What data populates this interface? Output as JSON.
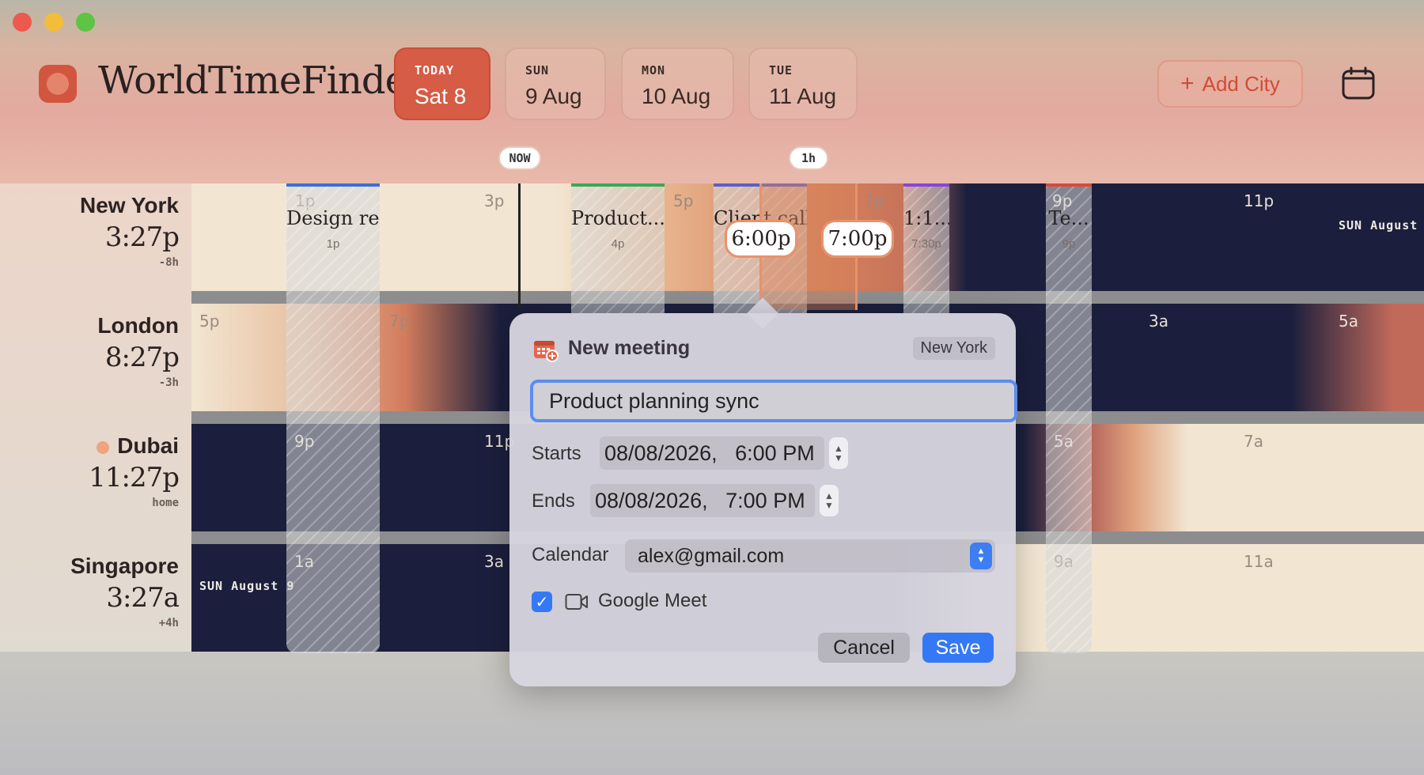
{
  "app": {
    "title": "WorldTimeFinder"
  },
  "days": [
    {
      "weekday": "TODAY",
      "date": "Sat 8",
      "active": true
    },
    {
      "weekday": "SUN",
      "date": "9 Aug"
    },
    {
      "weekday": "MON",
      "date": "10 Aug"
    },
    {
      "weekday": "TUE",
      "date": "11 Aug"
    }
  ],
  "header": {
    "add_city": "Add City",
    "add_icon": "+",
    "calendar_icon": "calendar-icon"
  },
  "markers": {
    "now": "NOW",
    "duration": "1h"
  },
  "cities": [
    {
      "name": "New York",
      "time": "3:27p",
      "offset": "-8h"
    },
    {
      "name": "London",
      "time": "8:27p",
      "offset": "-3h"
    },
    {
      "name": "Dubai",
      "time": "11:27p",
      "offset": "home"
    },
    {
      "name": "Singapore",
      "time": "3:27a",
      "offset": "+4h"
    }
  ],
  "ticks": {
    "ny": [
      "1p",
      "3p",
      "5p",
      "7p",
      "9p",
      "11p"
    ],
    "london": [
      "5p",
      "7p",
      "3a",
      "5a"
    ],
    "dubai": [
      "9p",
      "11p",
      "5a",
      "7a"
    ],
    "singapore": [
      "1a",
      "3a",
      "9a",
      "11a"
    ]
  },
  "date_labels": {
    "ny": "SUN August",
    "singapore": "SUN August 9"
  },
  "events": [
    {
      "title": "Design re...",
      "time": "1p",
      "color": "#3a6fd8"
    },
    {
      "title": "Product...",
      "time": "4p",
      "color": "#3aa856"
    },
    {
      "title": "Client call",
      "time": "",
      "color": "#5a60c8"
    },
    {
      "title": "1:1...",
      "time": "7:30p",
      "color": "#8a44d8"
    },
    {
      "title": "Te...",
      "time": "9p",
      "color": "#d84a3a"
    }
  ],
  "selection": {
    "start": "6:00p",
    "end": "7:00p"
  },
  "modal": {
    "title": "New meeting",
    "city": "New York",
    "meeting_name": "Product planning sync",
    "starts_label": "Starts",
    "starts_value": "08/08/2026,   6:00 PM",
    "ends_label": "Ends",
    "ends_value": "08/08/2026,   7:00 PM",
    "calendar_label": "Calendar",
    "calendar_value": "alex@gmail.com",
    "meet_label": "Google Meet",
    "meet_checked": true,
    "cancel": "Cancel",
    "save": "Save"
  },
  "colors": {
    "accent": "#d65c45",
    "primary_button": "#3478f6",
    "night": "#1b1f3d",
    "day": "#f0e6d4"
  }
}
